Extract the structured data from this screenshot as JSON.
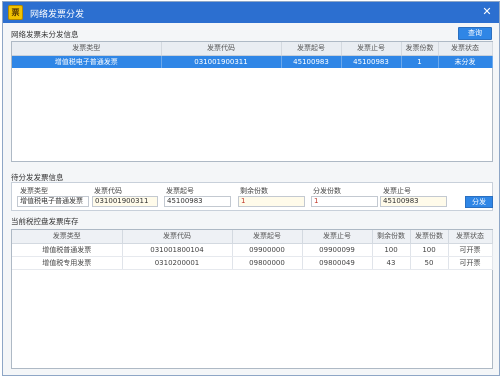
{
  "window": {
    "title": "网络发票分发",
    "icon": "invoice-app-icon",
    "close_label": "✕"
  },
  "unassigned": {
    "section_label": "网络发票未分发信息",
    "query_button": "查询",
    "columns": [
      "发票类型",
      "发票代码",
      "发票起号",
      "发票止号",
      "发票份数",
      "发票状态"
    ],
    "rows": [
      {
        "type": "增值税电子普通发票",
        "code": "031001900311",
        "start": "45100983",
        "end": "45100983",
        "count": "1",
        "status": "未分发"
      }
    ]
  },
  "assign": {
    "section_label": "待分发发票信息",
    "type_label": "发票类型",
    "type_value": "增值税电子普通发票",
    "code_label": "发票代码",
    "code_value": "031001900311",
    "start_label": "发票起号",
    "start_value": "45100983",
    "remaining_label": "剩余份数",
    "remaining_value": "1",
    "assign_count_label": "分发份数",
    "assign_count_value": "1",
    "end_label": "发票止号",
    "end_value": "45100983",
    "assign_button": "分发"
  },
  "inventory": {
    "section_label": "当前税控盘发票库存",
    "columns": [
      "发票类型",
      "发票代码",
      "发票起号",
      "发票止号",
      "剩余份数",
      "发票份数",
      "发票状态"
    ],
    "rows": [
      {
        "type": "增值税普通发票",
        "code": "031001800104",
        "start": "09900000",
        "end": "09900099",
        "remaining": "100",
        "count": "100",
        "status": "可开票"
      },
      {
        "type": "增值税专用发票",
        "code": "0310200001",
        "start": "09800000",
        "end": "09800049",
        "remaining": "43",
        "count": "50",
        "status": "可开票"
      }
    ]
  },
  "colors": {
    "titlebar": "#2c6fd0",
    "selected_row": "#2f86e6",
    "button": "#2f86e6"
  }
}
